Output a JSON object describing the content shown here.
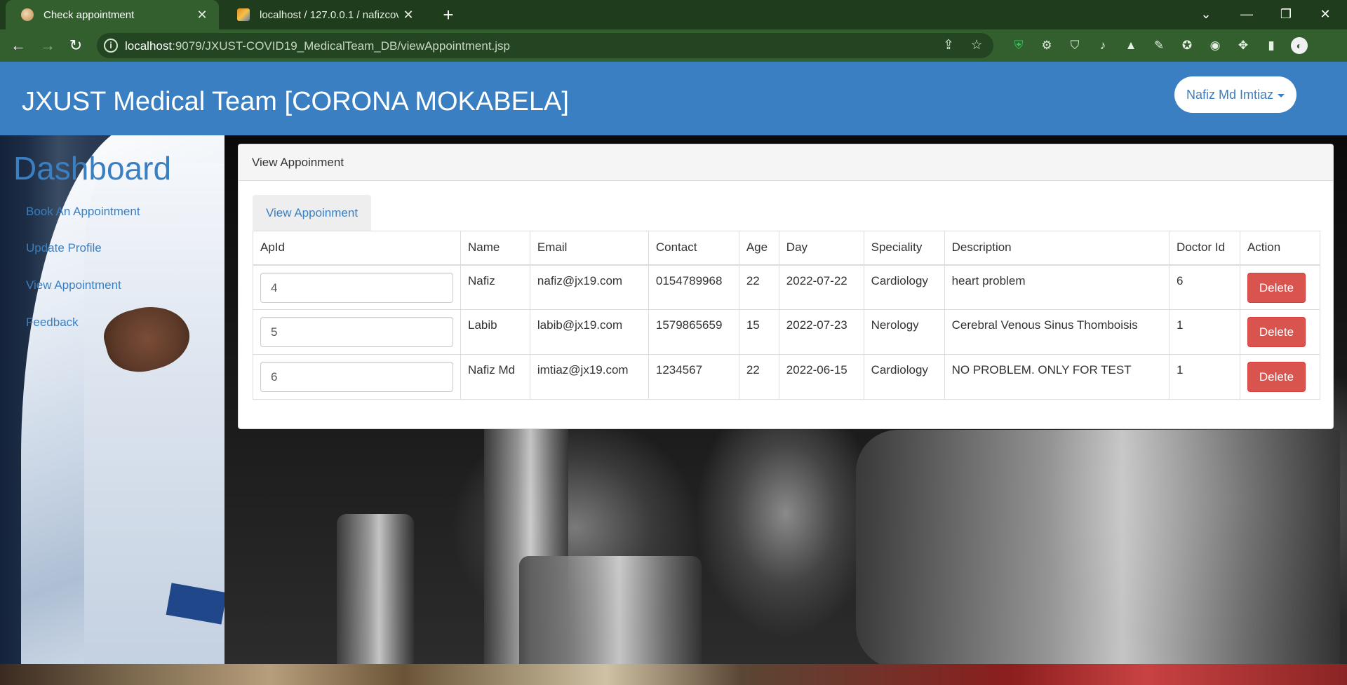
{
  "browser": {
    "tabs": [
      {
        "title": "Check appointment",
        "active": true
      },
      {
        "title": "localhost / 127.0.0.1 / nafizcovid19",
        "active": false
      }
    ],
    "url_host": "localhost",
    "url_rest": ":9079/JXUST-COVID19_MedicalTeam_DB/viewAppointment.jsp"
  },
  "navbar": {
    "brand": "JXUST Medical Team [CORONA MOKABELA]",
    "user_name": "Nafiz Md Imtiaz"
  },
  "sidebar": {
    "title": "Dashboard",
    "links": [
      "Book An Appointment",
      "Update Profile",
      "View Appointment",
      "Feedback"
    ]
  },
  "panel": {
    "heading": "View Appoinment",
    "tab_label": "View Appoinment",
    "delete_label": "Delete",
    "columns": [
      "ApId",
      "Name",
      "Email",
      "Contact",
      "Age",
      "Day",
      "Speciality",
      "Description",
      "Doctor Id",
      "Action"
    ],
    "rows": [
      {
        "apid": "4",
        "name": "Nafiz",
        "email": "nafiz@jx19.com",
        "contact": "0154789968",
        "age": "22",
        "day": "2022-07-22",
        "speciality": "Cardiology",
        "description": "heart problem",
        "doctor_id": "6"
      },
      {
        "apid": "5",
        "name": "Labib",
        "email": "labib@jx19.com",
        "contact": "1579865659",
        "age": "15",
        "day": "2022-07-23",
        "speciality": "Nerology",
        "description": "Cerebral Venous Sinus Thomboisis",
        "doctor_id": "1"
      },
      {
        "apid": "6",
        "name": "Nafiz Md",
        "email": "imtiaz@jx19.com",
        "contact": "1234567",
        "age": "22",
        "day": "2022-06-15",
        "speciality": "Cardiology",
        "description": "NO PROBLEM. ONLY FOR TEST",
        "doctor_id": "1"
      }
    ]
  },
  "colors": {
    "brand_blue": "#3a7fc1",
    "chrome_green": "#335f2e",
    "delete_red": "#d9534f"
  },
  "icons": {
    "back": "arrow-left-icon",
    "forward": "arrow-right-icon",
    "reload": "reload-icon",
    "info": "info-icon",
    "share": "share-icon",
    "bookmark": "star-icon"
  }
}
